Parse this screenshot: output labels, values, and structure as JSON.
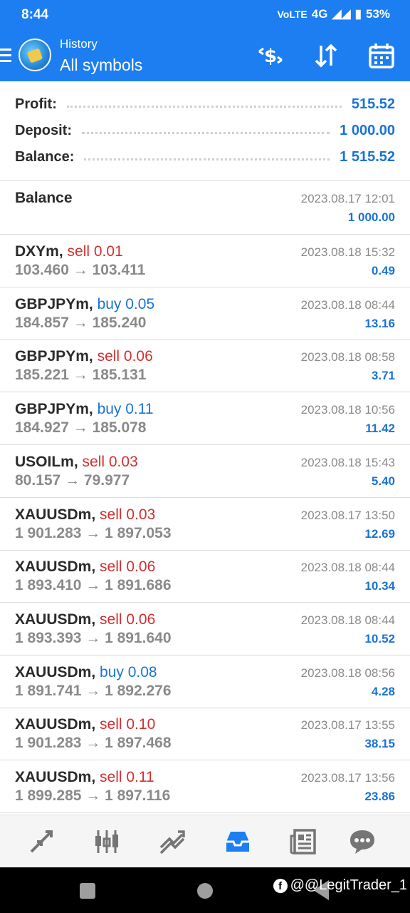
{
  "status_bar": {
    "time": "8:44",
    "network": "4G",
    "battery": "53%"
  },
  "header": {
    "subtitle": "History",
    "title": "All symbols"
  },
  "summary": {
    "profit_label": "Profit:",
    "profit_value": "515.52",
    "deposit_label": "Deposit:",
    "deposit_value": "1 000.00",
    "balance_label": "Balance:",
    "balance_value": "1 515.52"
  },
  "balance_entry": {
    "title": "Balance",
    "time": "2023.08.17 12:01",
    "amount": "1 000.00"
  },
  "deals": [
    {
      "symbol": "DXYm,",
      "side": "sell 0.01",
      "type": "sell",
      "prices": "103.460 → 103.411",
      "time": "2023.08.18 15:32",
      "profit": "0.49"
    },
    {
      "symbol": "GBPJPYm,",
      "side": "buy 0.05",
      "type": "buy",
      "prices": "184.857 → 185.240",
      "time": "2023.08.18 08:44",
      "profit": "13.16"
    },
    {
      "symbol": "GBPJPYm,",
      "side": "sell 0.06",
      "type": "sell",
      "prices": "185.221 → 185.131",
      "time": "2023.08.18 08:58",
      "profit": "3.71"
    },
    {
      "symbol": "GBPJPYm,",
      "side": "buy 0.11",
      "type": "buy",
      "prices": "184.927 → 185.078",
      "time": "2023.08.18 10:56",
      "profit": "11.42"
    },
    {
      "symbol": "USOILm,",
      "side": "sell 0.03",
      "type": "sell",
      "prices": "80.157 → 79.977",
      "time": "2023.08.18 15:43",
      "profit": "5.40"
    },
    {
      "symbol": "XAUUSDm,",
      "side": "sell 0.03",
      "type": "sell",
      "prices": "1 901.283 → 1 897.053",
      "time": "2023.08.17 13:50",
      "profit": "12.69"
    },
    {
      "symbol": "XAUUSDm,",
      "side": "sell 0.06",
      "type": "sell",
      "prices": "1 893.410 → 1 891.686",
      "time": "2023.08.18 08:44",
      "profit": "10.34"
    },
    {
      "symbol": "XAUUSDm,",
      "side": "sell 0.06",
      "type": "sell",
      "prices": "1 893.393 → 1 891.640",
      "time": "2023.08.18 08:44",
      "profit": "10.52"
    },
    {
      "symbol": "XAUUSDm,",
      "side": "buy 0.08",
      "type": "buy",
      "prices": "1 891.741 → 1 892.276",
      "time": "2023.08.18 08:56",
      "profit": "4.28"
    },
    {
      "symbol": "XAUUSDm,",
      "side": "sell 0.10",
      "type": "sell",
      "prices": "1 901.283 → 1 897.468",
      "time": "2023.08.17 13:55",
      "profit": "38.15"
    },
    {
      "symbol": "XAUUSDm,",
      "side": "sell 0.11",
      "type": "sell",
      "prices": "1 899.285 → 1 897.116",
      "time": "2023.08.17 13:56",
      "profit": "23.86"
    }
  ],
  "bottom_nav": [
    "quotes-icon",
    "chart-icon",
    "trade-icon",
    "history-icon",
    "news-icon",
    "chat-icon"
  ],
  "watermark": "@@LegitTrader_1",
  "colors": {
    "accent": "#1c7ef0",
    "sell": "#d32f2f",
    "buy": "#1a73d6"
  }
}
